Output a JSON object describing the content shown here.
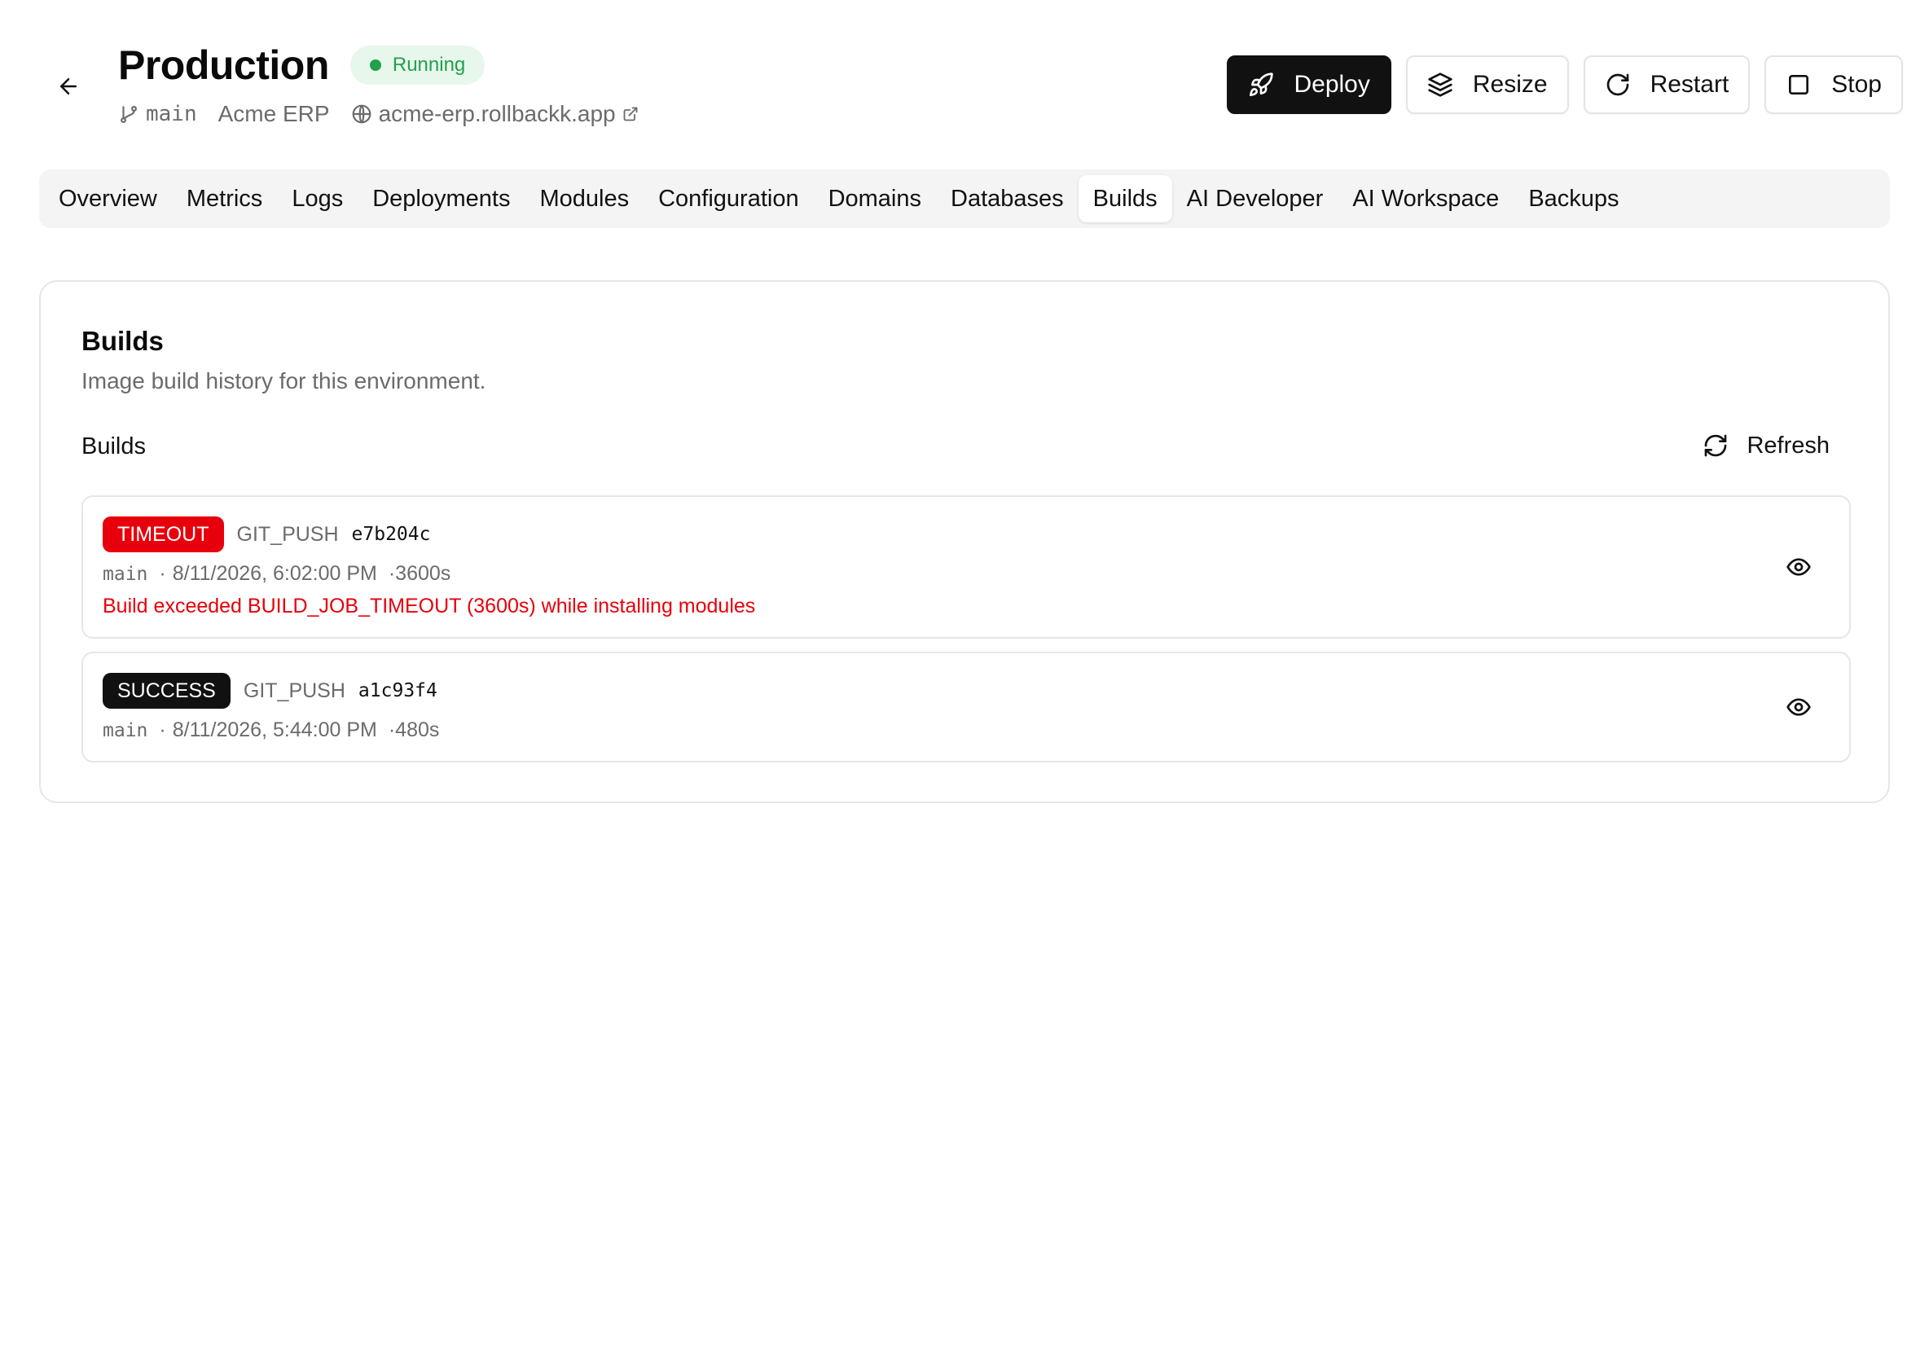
{
  "header": {
    "title": "Production",
    "status": "Running",
    "branch": "main",
    "app_name": "Acme ERP",
    "url": "acme-erp.rollbackk.app"
  },
  "actions": {
    "deploy": "Deploy",
    "resize": "Resize",
    "restart": "Restart",
    "stop": "Stop"
  },
  "tabs": [
    {
      "label": "Overview"
    },
    {
      "label": "Metrics"
    },
    {
      "label": "Logs"
    },
    {
      "label": "Deployments"
    },
    {
      "label": "Modules"
    },
    {
      "label": "Configuration"
    },
    {
      "label": "Domains"
    },
    {
      "label": "Databases"
    },
    {
      "label": "Builds",
      "active": true
    },
    {
      "label": "AI Developer"
    },
    {
      "label": "AI Workspace"
    },
    {
      "label": "Backups"
    }
  ],
  "card": {
    "title": "Builds",
    "description": "Image build history for this environment.",
    "section_label": "Builds",
    "refresh_label": "Refresh"
  },
  "builds": [
    {
      "status": "TIMEOUT",
      "trigger": "GIT_PUSH",
      "commit": "e7b204c",
      "branch": "main",
      "time": "8/11/2026, 6:02:00 PM",
      "duration": "3600s",
      "error": "Build exceeded BUILD_JOB_TIMEOUT (3600s) while installing modules"
    },
    {
      "status": "SUCCESS",
      "trigger": "GIT_PUSH",
      "commit": "a1c93f4",
      "branch": "main",
      "time": "8/11/2026, 5:44:00 PM",
      "duration": "480s"
    }
  ],
  "colors": {
    "running": "#22a04a",
    "running_bg": "#e8f7ec",
    "timeout": "#e7000b",
    "success": "#111111",
    "primary_button": "#111111"
  }
}
